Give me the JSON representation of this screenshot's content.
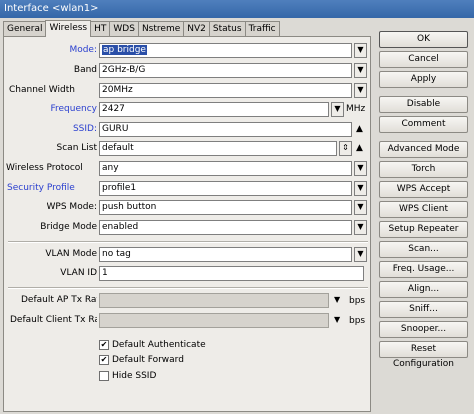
{
  "window": {
    "title": "Interface <wlan1>"
  },
  "tabs": [
    "General",
    "Wireless",
    "HT",
    "WDS",
    "Nstreme",
    "NV2",
    "Status",
    "Traffic"
  ],
  "form": {
    "mode": {
      "label": "Mode:",
      "value": "ap bridge"
    },
    "band": {
      "label": "Band",
      "value": "2GHz-B/G"
    },
    "channel_width": {
      "label": "Channel Width",
      "value": "20MHz"
    },
    "frequency": {
      "label": "Frequency",
      "value": "2427",
      "unit": "MHz"
    },
    "ssid": {
      "label": "SSID:",
      "value": "GURU"
    },
    "scan_list": {
      "label": "Scan List",
      "value": "default"
    },
    "wireless_protocol": {
      "label": "Wireless Protocol",
      "value": "any"
    },
    "security_profile": {
      "label": "Security Profile",
      "value": "profile1"
    },
    "wps_mode": {
      "label": "WPS Mode:",
      "value": "push button"
    },
    "bridge_mode": {
      "label": "Bridge Mode",
      "value": "enabled"
    },
    "vlan_mode": {
      "label": "VLAN Mode",
      "value": "no tag"
    },
    "vlan_id": {
      "label": "VLAN ID",
      "value": "1"
    },
    "default_ap_tx_rate": {
      "label": "Default AP Tx Rate",
      "value": "",
      "unit": "bps"
    },
    "default_client_tx_rate": {
      "label": "Default Client Tx Rate",
      "value": "",
      "unit": "bps"
    },
    "checkboxes": [
      {
        "label": "Default Authenticate",
        "checked": true
      },
      {
        "label": "Default Forward",
        "checked": true
      },
      {
        "label": "Hide SSID",
        "checked": false
      }
    ]
  },
  "buttons": [
    "OK",
    "Cancel",
    "Apply",
    "Disable",
    "Comment",
    "Advanced Mode",
    "Torch",
    "WPS Accept",
    "WPS Client",
    "Setup Repeater",
    "Scan...",
    "Freq. Usage...",
    "Align...",
    "Sniff...",
    "Snooper...",
    "Reset Configuration"
  ],
  "glyphs": {
    "dropdown": "▼",
    "dropdown_double": "⇕",
    "up": "▲",
    "check": "✔"
  }
}
